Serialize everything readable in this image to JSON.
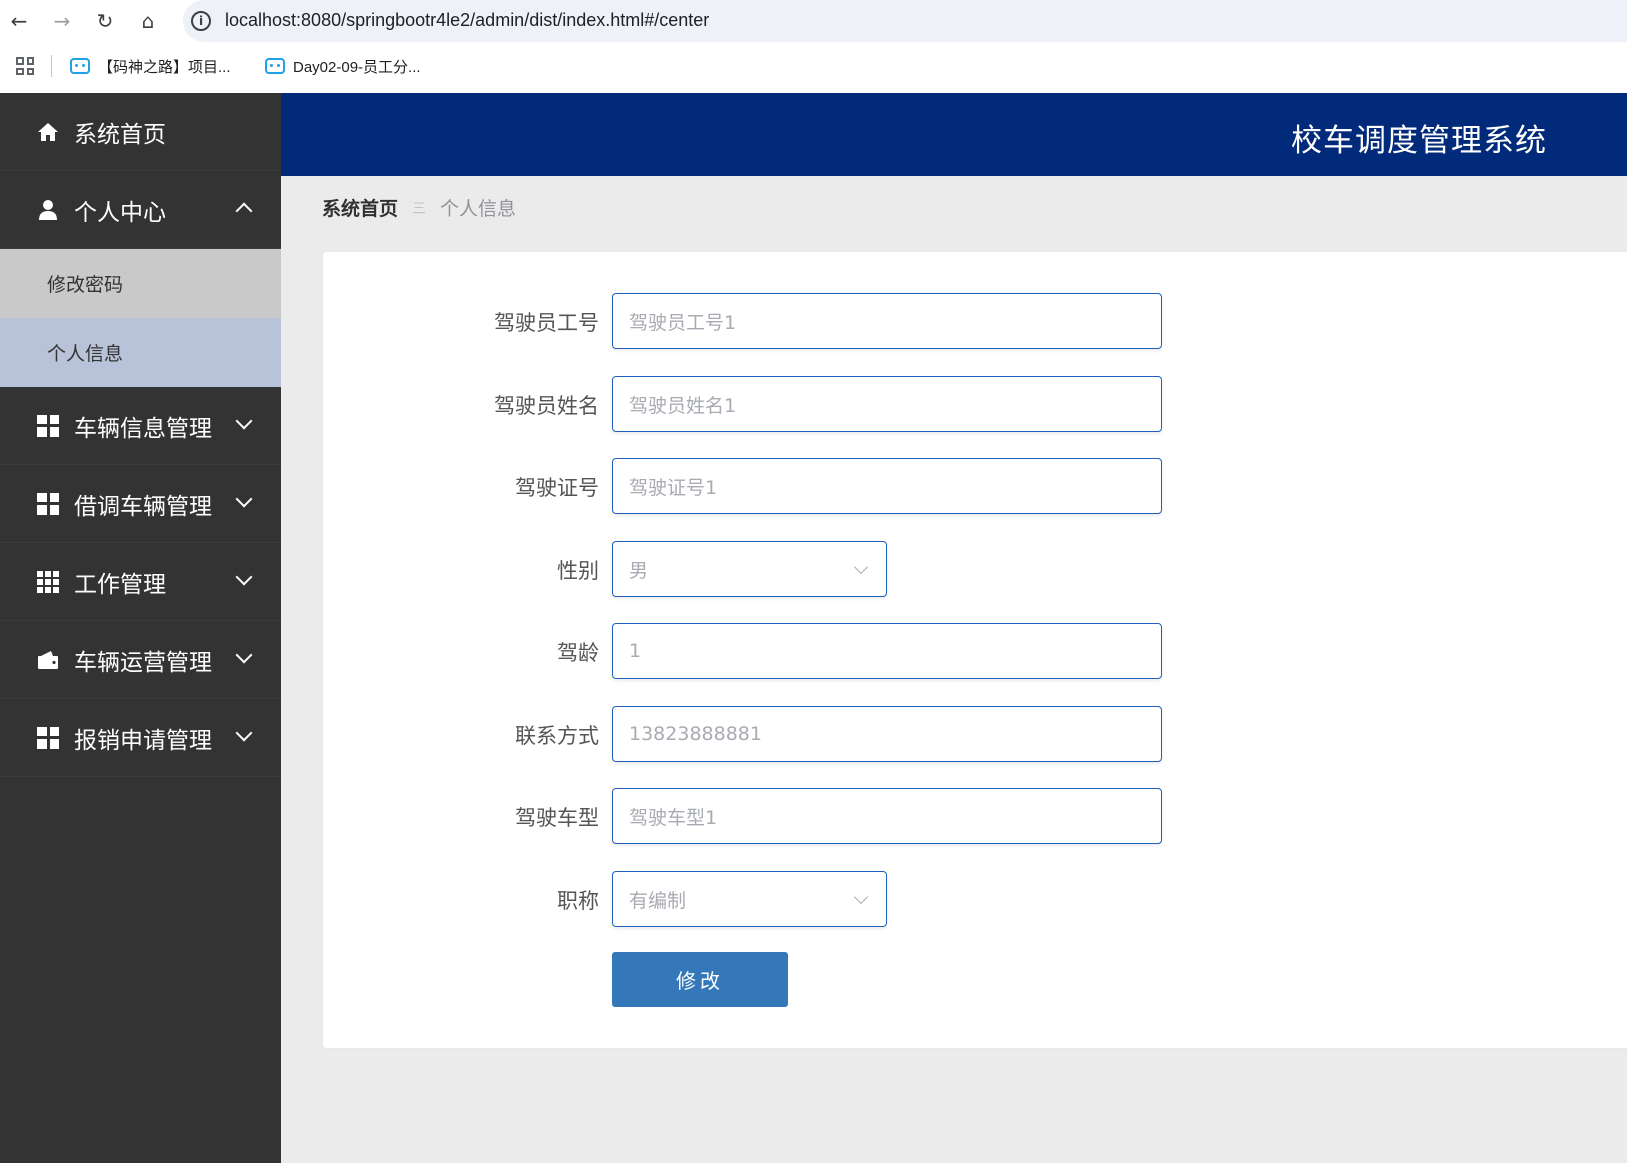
{
  "browser": {
    "url": "localhost:8080/springbootr4le2/admin/dist/index.html#/center",
    "bookmarks": [
      "【码神之路】项目...",
      "Day02-09-员工分..."
    ]
  },
  "app": {
    "title": "校车调度管理系统"
  },
  "sidebar": {
    "items": [
      {
        "label": "系统首页",
        "icon": "home-icon"
      },
      {
        "label": "个人中心",
        "icon": "user-icon",
        "expanded": true,
        "children": [
          "修改密码",
          "个人信息"
        ]
      },
      {
        "label": "车辆信息管理",
        "icon": "grid-icon"
      },
      {
        "label": "借调车辆管理",
        "icon": "grid-icon"
      },
      {
        "label": "工作管理",
        "icon": "grid9-icon"
      },
      {
        "label": "车辆运营管理",
        "icon": "wallet-icon"
      },
      {
        "label": "报销申请管理",
        "icon": "grid-icon"
      }
    ]
  },
  "breadcrumb": {
    "home": "系统首页",
    "separator": "三",
    "current": "个人信息"
  },
  "form": {
    "fields": [
      {
        "label": "驾驶员工号",
        "value": "驾驶员工号1"
      },
      {
        "label": "驾驶员姓名",
        "value": "驾驶员姓名1"
      },
      {
        "label": "驾驶证号",
        "value": "驾驶证号1"
      },
      {
        "label": "性别",
        "value": "男"
      },
      {
        "label": "驾龄",
        "value": "1"
      },
      {
        "label": "联系方式",
        "value": "13823888881"
      },
      {
        "label": "驾驶车型",
        "value": "驾驶车型1"
      },
      {
        "label": "职称",
        "value": "有编制"
      }
    ],
    "submit_label": "修改"
  },
  "colors": {
    "header": "#012a7a",
    "sidebar": "#333333",
    "active_sub": "#b8c2d8",
    "button": "#3578b9"
  }
}
